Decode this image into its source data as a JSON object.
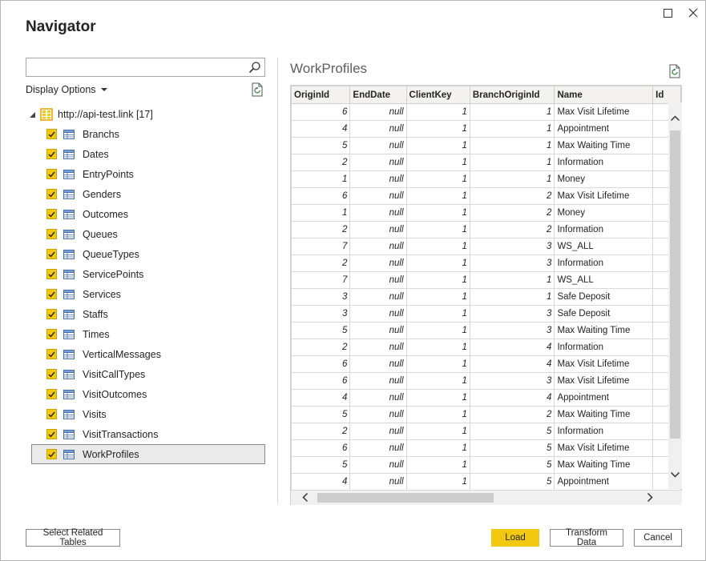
{
  "window": {
    "title": "Navigator"
  },
  "search": {
    "placeholder": "",
    "value": ""
  },
  "display_options_label": "Display Options",
  "tree": {
    "root_label": "http://api-test.link [17]",
    "items": [
      {
        "label": "Branchs",
        "checked": true
      },
      {
        "label": "Dates",
        "checked": true
      },
      {
        "label": "EntryPoints",
        "checked": true
      },
      {
        "label": "Genders",
        "checked": true
      },
      {
        "label": "Outcomes",
        "checked": true
      },
      {
        "label": "Queues",
        "checked": true
      },
      {
        "label": "QueueTypes",
        "checked": true
      },
      {
        "label": "ServicePoints",
        "checked": true
      },
      {
        "label": "Services",
        "checked": true
      },
      {
        "label": "Staffs",
        "checked": true
      },
      {
        "label": "Times",
        "checked": true
      },
      {
        "label": "VerticalMessages",
        "checked": true
      },
      {
        "label": "VisitCallTypes",
        "checked": true
      },
      {
        "label": "VisitOutcomes",
        "checked": true
      },
      {
        "label": "Visits",
        "checked": true
      },
      {
        "label": "VisitTransactions",
        "checked": true
      },
      {
        "label": "WorkProfiles",
        "checked": true
      }
    ],
    "selected": "WorkProfiles"
  },
  "preview": {
    "title": "WorkProfiles",
    "columns": [
      "OriginId",
      "EndDate",
      "ClientKey",
      "BranchOriginId",
      "Name",
      "Id"
    ],
    "rows": [
      [
        "6",
        "null",
        "1",
        "1",
        "Max Visit Lifetime"
      ],
      [
        "4",
        "null",
        "1",
        "1",
        "Appointment"
      ],
      [
        "5",
        "null",
        "1",
        "1",
        "Max Waiting Time"
      ],
      [
        "2",
        "null",
        "1",
        "1",
        "Information"
      ],
      [
        "1",
        "null",
        "1",
        "1",
        "Money"
      ],
      [
        "6",
        "null",
        "1",
        "2",
        "Max Visit Lifetime"
      ],
      [
        "1",
        "null",
        "1",
        "2",
        "Money"
      ],
      [
        "2",
        "null",
        "1",
        "2",
        "Information"
      ],
      [
        "7",
        "null",
        "1",
        "3",
        "WS_ALL"
      ],
      [
        "2",
        "null",
        "1",
        "3",
        "Information"
      ],
      [
        "7",
        "null",
        "1",
        "1",
        "WS_ALL"
      ],
      [
        "3",
        "null",
        "1",
        "1",
        "Safe Deposit"
      ],
      [
        "3",
        "null",
        "1",
        "3",
        "Safe Deposit"
      ],
      [
        "5",
        "null",
        "1",
        "3",
        "Max Waiting Time"
      ],
      [
        "2",
        "null",
        "1",
        "4",
        "Information"
      ],
      [
        "6",
        "null",
        "1",
        "4",
        "Max Visit Lifetime"
      ],
      [
        "6",
        "null",
        "1",
        "3",
        "Max Visit Lifetime"
      ],
      [
        "4",
        "null",
        "1",
        "4",
        "Appointment"
      ],
      [
        "5",
        "null",
        "1",
        "2",
        "Max Waiting Time"
      ],
      [
        "2",
        "null",
        "1",
        "5",
        "Information"
      ],
      [
        "6",
        "null",
        "1",
        "5",
        "Max Visit Lifetime"
      ],
      [
        "5",
        "null",
        "1",
        "5",
        "Max Waiting Time"
      ],
      [
        "4",
        "null",
        "1",
        "5",
        "Appointment"
      ]
    ]
  },
  "buttons": {
    "select_related": "Select Related Tables",
    "load": "Load",
    "transform": "Transform Data",
    "cancel": "Cancel"
  },
  "colors": {
    "accent": "#f2c811",
    "selection": "#eaeaea"
  }
}
